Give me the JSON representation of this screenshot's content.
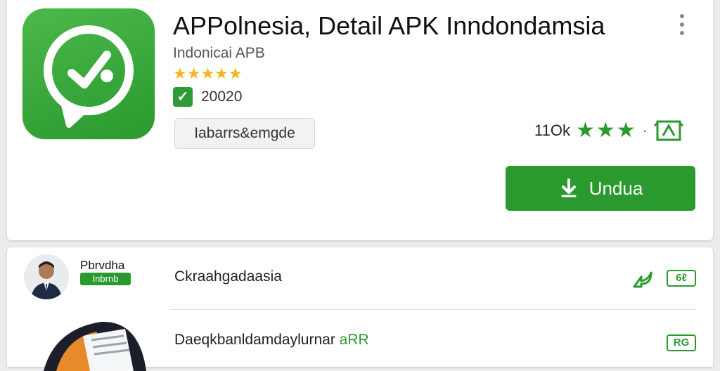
{
  "app": {
    "title": "APPolnesia, Detail APK Inndondamsia",
    "subtitle": "Indonicai APB",
    "stars": "★★★★★",
    "verified_mark": "✓",
    "verified_count": "20020",
    "tag": "Iabarrs&emgde",
    "rating_count": "11Ok",
    "rating_stars": "★★★",
    "rating_dot": "·",
    "download_label": "Undua",
    "icon_name": "chat-check-icon"
  },
  "developer": {
    "name": "Pbrvdha",
    "badge": "Inbrnb",
    "row_text": "Ckraahgadaasia",
    "mini_badge": "6ℓ"
  },
  "second_row": {
    "text": "Daeqkbanldamdaylurnar",
    "highlight": "aRR",
    "mini_badge": "RG"
  },
  "colors": {
    "accent": "#2a9a2f",
    "star": "#f3b61f"
  }
}
